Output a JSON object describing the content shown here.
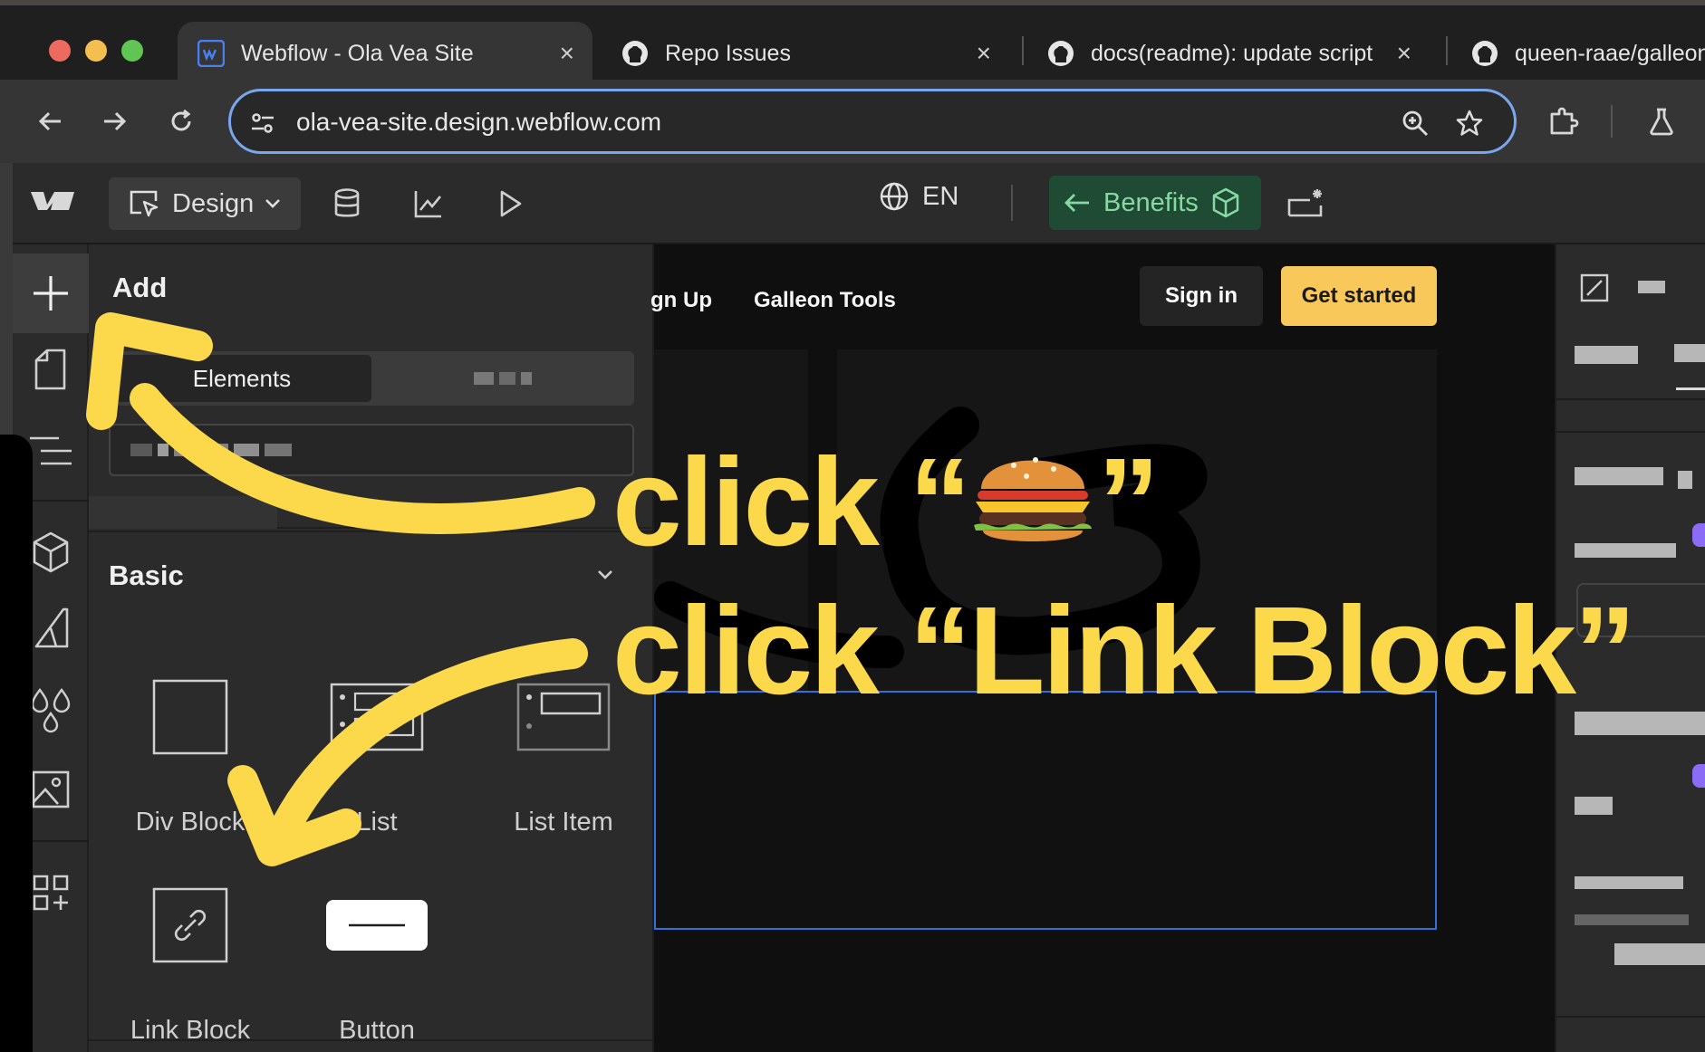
{
  "browser": {
    "tabs": [
      {
        "title": "Webflow - Ola Vea Site",
        "icon": "webflow-favicon",
        "active": true
      },
      {
        "title": "Repo Issues",
        "icon": "github-icon",
        "active": false
      },
      {
        "title": "docs(readme): update script",
        "icon": "github-icon",
        "active": false
      },
      {
        "title": "queen-raae/galleon",
        "icon": "github-icon",
        "active": false
      }
    ],
    "close_glyph": "×",
    "url": "ola-vea-site.design.webflow.com"
  },
  "app": {
    "mode_label": "Design",
    "locale": "EN",
    "page_label": "Benefits"
  },
  "add_panel": {
    "title": "Add",
    "segment_elements": "Elements",
    "section_title": "Basic",
    "tiles": [
      {
        "label": "Div Block",
        "icon": "div-block-icon"
      },
      {
        "label": "List",
        "icon": "list-icon"
      },
      {
        "label": "List Item",
        "icon": "list-item-icon"
      },
      {
        "label": "Link Block",
        "icon": "link-block-icon"
      },
      {
        "label": "Button",
        "icon": "button-icon"
      }
    ]
  },
  "site": {
    "nav_partial": "gn Up",
    "nav_link": "Galleon Tools",
    "sign_in": "Sign in",
    "get_started": "Get started"
  },
  "annotations": {
    "line1_prefix": "click “",
    "line1_suffix": "”",
    "line2": "click “Link Block”",
    "color": "#fbd94a"
  }
}
